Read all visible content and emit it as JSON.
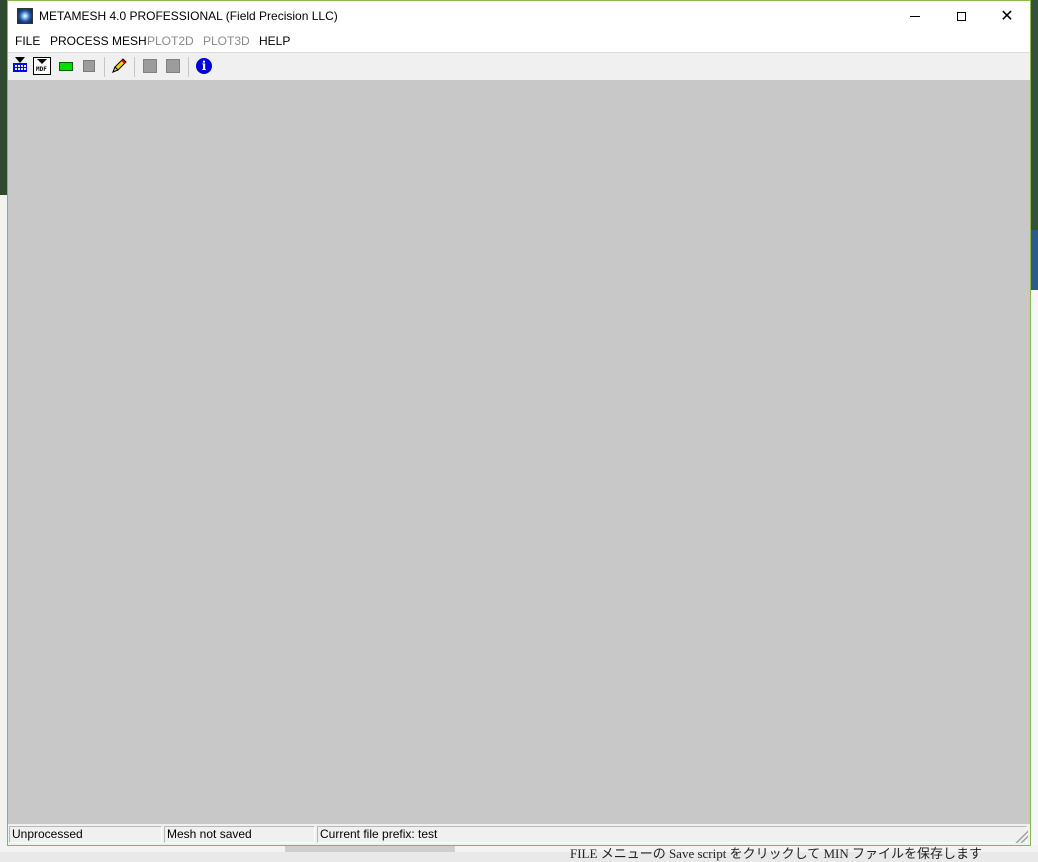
{
  "window": {
    "title": "METAMESH 4.0 PROFESSIONAL (Field Precision LLC)"
  },
  "menu": [
    {
      "label": "FILE",
      "enabled": true
    },
    {
      "label": "PROCESS MESH",
      "enabled": true
    },
    {
      "label": "PLOT2D",
      "enabled": false
    },
    {
      "label": "PLOT3D",
      "enabled": false
    },
    {
      "label": "HELP",
      "enabled": true
    }
  ],
  "toolbar": {
    "mdf_icon_text": "MDF"
  },
  "status": {
    "process_state": "Unprocessed",
    "save_state": "Mesh not saved",
    "file_prefix": "Current file prefix: test"
  },
  "background": {
    "bottom_text": "FILE メニューの Save script をクリックして MIN ファイルを保存します"
  },
  "colors": {
    "canvas": "#c8c8c8",
    "window_border": "#86b850"
  }
}
